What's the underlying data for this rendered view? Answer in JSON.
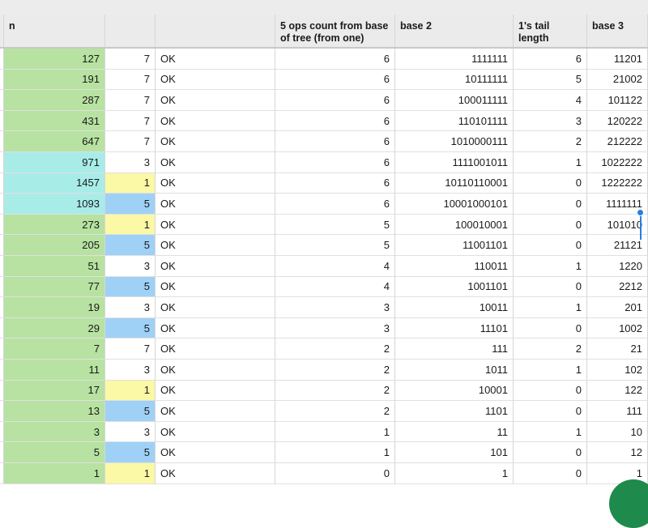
{
  "headers": {
    "n": "n",
    "b": "",
    "c": "",
    "ops": "5 ops count from base of tree (from one)",
    "base2": "base 2",
    "tail": "1's tail length",
    "base3": "base 3"
  },
  "rows": [
    {
      "n": "127",
      "b": "7",
      "c": "OK",
      "ops": "6",
      "base2": "1111111",
      "tail": "6",
      "base3": "11201",
      "nColor": "green",
      "bColor": ""
    },
    {
      "n": "191",
      "b": "7",
      "c": "OK",
      "ops": "6",
      "base2": "10111111",
      "tail": "5",
      "base3": "21002",
      "nColor": "green",
      "bColor": ""
    },
    {
      "n": "287",
      "b": "7",
      "c": "OK",
      "ops": "6",
      "base2": "100011111",
      "tail": "4",
      "base3": "101122",
      "nColor": "green",
      "bColor": ""
    },
    {
      "n": "431",
      "b": "7",
      "c": "OK",
      "ops": "6",
      "base2": "110101111",
      "tail": "3",
      "base3": "120222",
      "nColor": "green",
      "bColor": ""
    },
    {
      "n": "647",
      "b": "7",
      "c": "OK",
      "ops": "6",
      "base2": "1010000111",
      "tail": "2",
      "base3": "212222",
      "nColor": "green",
      "bColor": ""
    },
    {
      "n": "971",
      "b": "3",
      "c": "OK",
      "ops": "6",
      "base2": "1111001011",
      "tail": "1",
      "base3": "1022222",
      "nColor": "cyan",
      "bColor": ""
    },
    {
      "n": "1457",
      "b": "1",
      "c": "OK",
      "ops": "6",
      "base2": "10110110001",
      "tail": "0",
      "base3": "1222222",
      "nColor": "cyan",
      "bColor": "yellow"
    },
    {
      "n": "1093",
      "b": "5",
      "c": "OK",
      "ops": "6",
      "base2": "10001000101",
      "tail": "0",
      "base3": "1111111",
      "nColor": "cyan",
      "bColor": "blue"
    },
    {
      "n": "273",
      "b": "1",
      "c": "OK",
      "ops": "5",
      "base2": "100010001",
      "tail": "0",
      "base3": "101010",
      "nColor": "green",
      "bColor": "yellow"
    },
    {
      "n": "205",
      "b": "5",
      "c": "OK",
      "ops": "5",
      "base2": "11001101",
      "tail": "0",
      "base3": "21121",
      "nColor": "green",
      "bColor": "blue"
    },
    {
      "n": "51",
      "b": "3",
      "c": "OK",
      "ops": "4",
      "base2": "110011",
      "tail": "1",
      "base3": "1220",
      "nColor": "green",
      "bColor": ""
    },
    {
      "n": "77",
      "b": "5",
      "c": "OK",
      "ops": "4",
      "base2": "1001101",
      "tail": "0",
      "base3": "2212",
      "nColor": "green",
      "bColor": "blue"
    },
    {
      "n": "19",
      "b": "3",
      "c": "OK",
      "ops": "3",
      "base2": "10011",
      "tail": "1",
      "base3": "201",
      "nColor": "green",
      "bColor": ""
    },
    {
      "n": "29",
      "b": "5",
      "c": "OK",
      "ops": "3",
      "base2": "11101",
      "tail": "0",
      "base3": "1002",
      "nColor": "green",
      "bColor": "blue"
    },
    {
      "n": "7",
      "b": "7",
      "c": "OK",
      "ops": "2",
      "base2": "111",
      "tail": "2",
      "base3": "21",
      "nColor": "green",
      "bColor": ""
    },
    {
      "n": "11",
      "b": "3",
      "c": "OK",
      "ops": "2",
      "base2": "1011",
      "tail": "1",
      "base3": "102",
      "nColor": "green",
      "bColor": ""
    },
    {
      "n": "17",
      "b": "1",
      "c": "OK",
      "ops": "2",
      "base2": "10001",
      "tail": "0",
      "base3": "122",
      "nColor": "green",
      "bColor": "yellow"
    },
    {
      "n": "13",
      "b": "5",
      "c": "OK",
      "ops": "2",
      "base2": "1101",
      "tail": "0",
      "base3": "111",
      "nColor": "green",
      "bColor": "blue"
    },
    {
      "n": "3",
      "b": "3",
      "c": "OK",
      "ops": "1",
      "base2": "11",
      "tail": "1",
      "base3": "10",
      "nColor": "green",
      "bColor": ""
    },
    {
      "n": "5",
      "b": "5",
      "c": "OK",
      "ops": "1",
      "base2": "101",
      "tail": "0",
      "base3": "12",
      "nColor": "green",
      "bColor": "blue"
    },
    {
      "n": "1",
      "b": "1",
      "c": "OK",
      "ops": "0",
      "base2": "1",
      "tail": "0",
      "base3": "1",
      "nColor": "green",
      "bColor": "yellow"
    }
  ],
  "colors": {
    "green": "#b7e2a1",
    "cyan": "#a8ece8",
    "yellow": "#fbf8a6",
    "blue": "#9fd1f7",
    "selection": "#2a7de1",
    "fab": "#1e8a4c"
  }
}
